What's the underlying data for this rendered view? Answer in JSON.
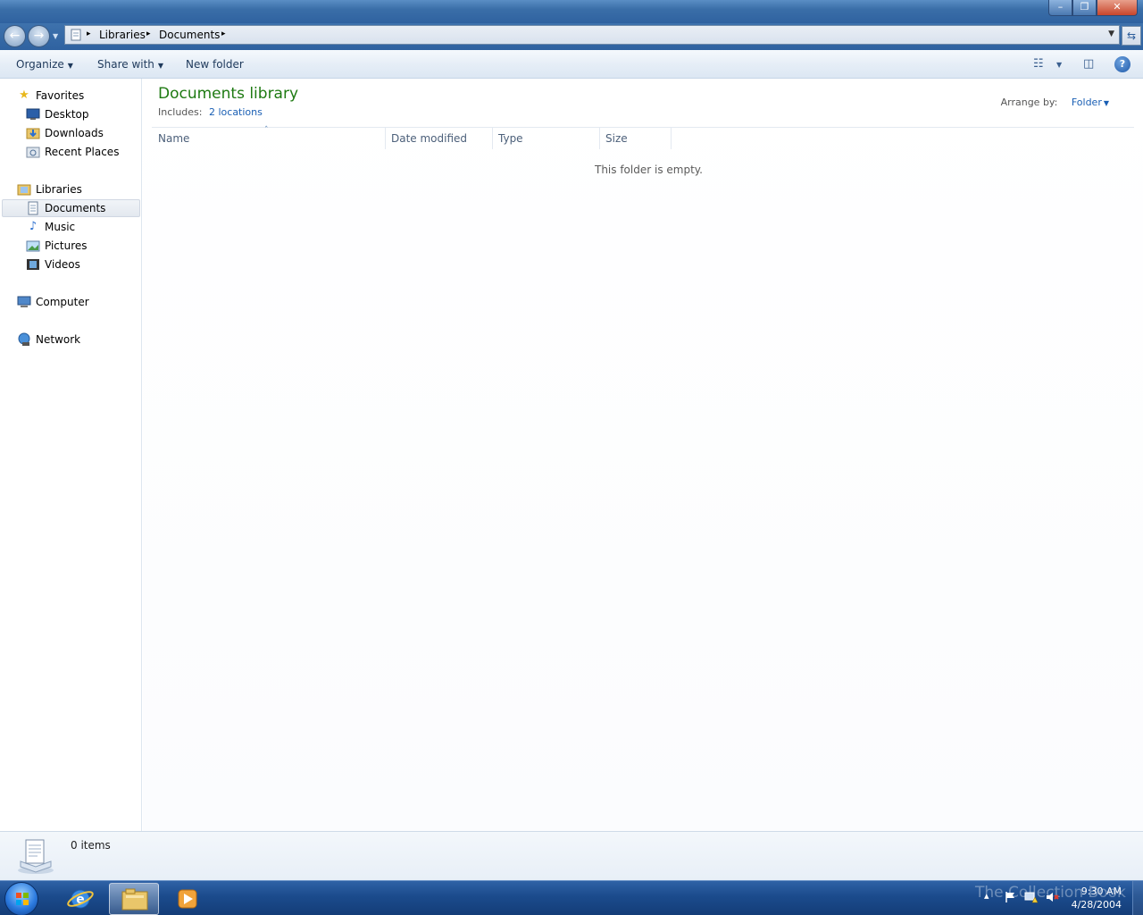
{
  "window": {
    "minimize_glyph": "–",
    "maximize_glyph": "❐",
    "close_glyph": "✕"
  },
  "address": {
    "back_glyph": "←",
    "forward_glyph": "→",
    "crumbs": [
      "Libraries",
      "Documents"
    ],
    "separator_glyph": "▸",
    "dropdown_glyph": "▼",
    "refresh_glyph": "⇆"
  },
  "toolbar": {
    "organize_label": "Organize",
    "share_label": "Share with",
    "new_folder_label": "New folder",
    "arrow_glyph": "▼",
    "view_glyph": "☷",
    "preview_glyph": "◫",
    "help_glyph": "?"
  },
  "nav": {
    "favorites": "Favorites",
    "desktop": "Desktop",
    "downloads": "Downloads",
    "recent_places": "Recent Places",
    "libraries": "Libraries",
    "documents": "Documents",
    "music": "Music",
    "pictures": "Pictures",
    "videos": "Videos",
    "computer": "Computer",
    "network": "Network"
  },
  "content": {
    "title": "Documents library",
    "includes_label": "Includes:",
    "includes_link": "2 locations",
    "arrange_label": "Arrange by:",
    "arrange_value": "Folder",
    "columns": [
      "Name",
      "Date modified",
      "Type",
      "Size"
    ],
    "sort_glyph": "ˆ",
    "empty_message": "This folder is empty."
  },
  "details": {
    "item_count": "0 items"
  },
  "taskbar": {
    "watermark": "The Collection Book",
    "time": "9:30 AM",
    "date": "4/28/2004",
    "tray_up_glyph": "▴"
  },
  "colors": {
    "library_title": "#1e7a12",
    "link": "#1a5fb4",
    "taskbar": "#1b4b8c"
  }
}
